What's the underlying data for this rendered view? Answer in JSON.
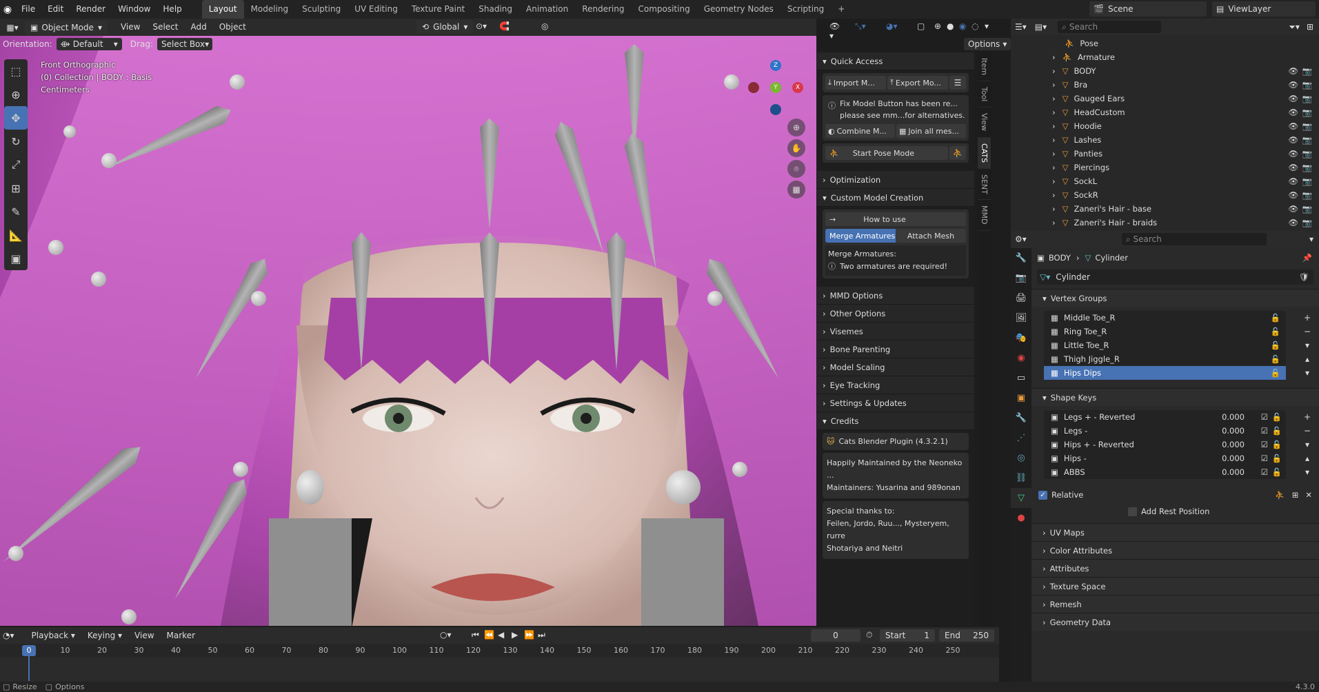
{
  "topbar": {
    "menus": [
      "File",
      "Edit",
      "Render",
      "Window",
      "Help"
    ],
    "workspaces": [
      "Layout",
      "Modeling",
      "Sculpting",
      "UV Editing",
      "Texture Paint",
      "Shading",
      "Animation",
      "Rendering",
      "Compositing",
      "Geometry Nodes",
      "Scripting"
    ],
    "scene": "Scene",
    "view_layer": "ViewLayer"
  },
  "viewport_header": {
    "mode": "Object Mode",
    "menus": [
      "View",
      "Select",
      "Add",
      "Object"
    ],
    "transform": "Global",
    "orientation_label": "Orientation:",
    "orientation_value": "Default",
    "drag_label": "Drag:",
    "drag_value": "Select Box",
    "options": "Options"
  },
  "viewport_overlay": {
    "view_name": "Front Orthographic",
    "collection": "(0) Collection | BODY : Basis",
    "units": "Centimeters",
    "gizmo": {
      "x": "X",
      "y": "Y",
      "z": "Z"
    }
  },
  "npanel": {
    "quick_access": "Quick Access",
    "import": "Import M...",
    "export": "Export Mo...",
    "fix_notice": "Fix Model Button has been re...",
    "fix_notice2": "please see mm...for alternatives.",
    "combine": "Combine M...",
    "join": "Join all mes...",
    "start_pose": "Start Pose Mode",
    "optimization": "Optimization",
    "custom_model": "Custom Model Creation",
    "how_to_use": "How to use",
    "merge_armatures": "Merge Armatures",
    "attach_mesh": "Attach Mesh",
    "merge_label": "Merge Armatures:",
    "two_required": "Two armatures are required!",
    "mmd_options": "MMD Options",
    "other_options": "Other Options",
    "visemes": "Visemes",
    "bone_parenting": "Bone Parenting",
    "model_scaling": "Model Scaling",
    "eye_tracking": "Eye Tracking",
    "settings_updates": "Settings & Updates",
    "credits": "Credits",
    "plugin_name": "Cats Blender Plugin (4.3.2.1)",
    "maintained": "Happily Maintained by the Neoneko ...",
    "maintainers": "Maintainers: Yusarina and 989onan",
    "thanks": "Special thanks to:",
    "thanks2": "Feilen, Jordo, Ruu..., Mysteryem, rurre",
    "thanks3": "Shotariya and Neitri"
  },
  "sidetabs": [
    "Item",
    "Tool",
    "View",
    "CATS",
    "SENT",
    "MMD"
  ],
  "outliner": {
    "search_placeholder": "Search",
    "items": [
      {
        "name": "Pose",
        "type": "pose"
      },
      {
        "name": "Armature",
        "type": "armature"
      },
      {
        "name": "BODY",
        "type": "mesh"
      },
      {
        "name": "Bra",
        "type": "mesh"
      },
      {
        "name": "Gauged Ears",
        "type": "mesh"
      },
      {
        "name": "HeadCustom",
        "type": "mesh"
      },
      {
        "name": "Hoodie",
        "type": "mesh"
      },
      {
        "name": "Lashes",
        "type": "mesh"
      },
      {
        "name": "Panties",
        "type": "mesh"
      },
      {
        "name": "Piercings",
        "type": "mesh"
      },
      {
        "name": "SockL",
        "type": "mesh"
      },
      {
        "name": "SockR",
        "type": "mesh"
      },
      {
        "name": "Zaneri's Hair - base",
        "type": "mesh"
      },
      {
        "name": "Zaneri's Hair - braids",
        "type": "mesh"
      }
    ]
  },
  "properties": {
    "search_placeholder": "Search",
    "breadcrumb_object": "BODY",
    "breadcrumb_data": "Cylinder",
    "data_name": "Cylinder",
    "vertex_groups": "Vertex Groups",
    "vgroups": [
      "Middle Toe_R",
      "Ring Toe_R",
      "Little Toe_R",
      "Thigh Jiggle_R",
      "Hips Dips"
    ],
    "shape_keys": "Shape Keys",
    "skeys": [
      {
        "name": "Legs + - Reverted",
        "value": "0.000"
      },
      {
        "name": "Legs -",
        "value": "0.000"
      },
      {
        "name": "Hips + - Reverted",
        "value": "0.000"
      },
      {
        "name": "Hips -",
        "value": "0.000"
      },
      {
        "name": "ABBS",
        "value": "0.000"
      }
    ],
    "relative": "Relative",
    "add_rest": "Add Rest Position",
    "sections": [
      "UV Maps",
      "Color Attributes",
      "Attributes",
      "Texture Space",
      "Remesh",
      "Geometry Data"
    ]
  },
  "timeline": {
    "menus": [
      "Playback",
      "Keying",
      "View",
      "Marker"
    ],
    "current_frame": "0",
    "start_label": "Start",
    "start": "1",
    "end_label": "End",
    "end": "250",
    "ticks": [
      "0",
      "10",
      "20",
      "30",
      "40",
      "50",
      "60",
      "70",
      "80",
      "90",
      "100",
      "110",
      "120",
      "130",
      "140",
      "150",
      "160",
      "170",
      "180",
      "190",
      "200",
      "210",
      "220",
      "230",
      "240",
      "250"
    ]
  },
  "statusbar": {
    "resize": "Resize",
    "options": "Options",
    "version": "4.3.0"
  },
  "colors": {
    "accent": "#4772b3",
    "hair": "#c45cc0",
    "panel": "#2a2a2a"
  }
}
